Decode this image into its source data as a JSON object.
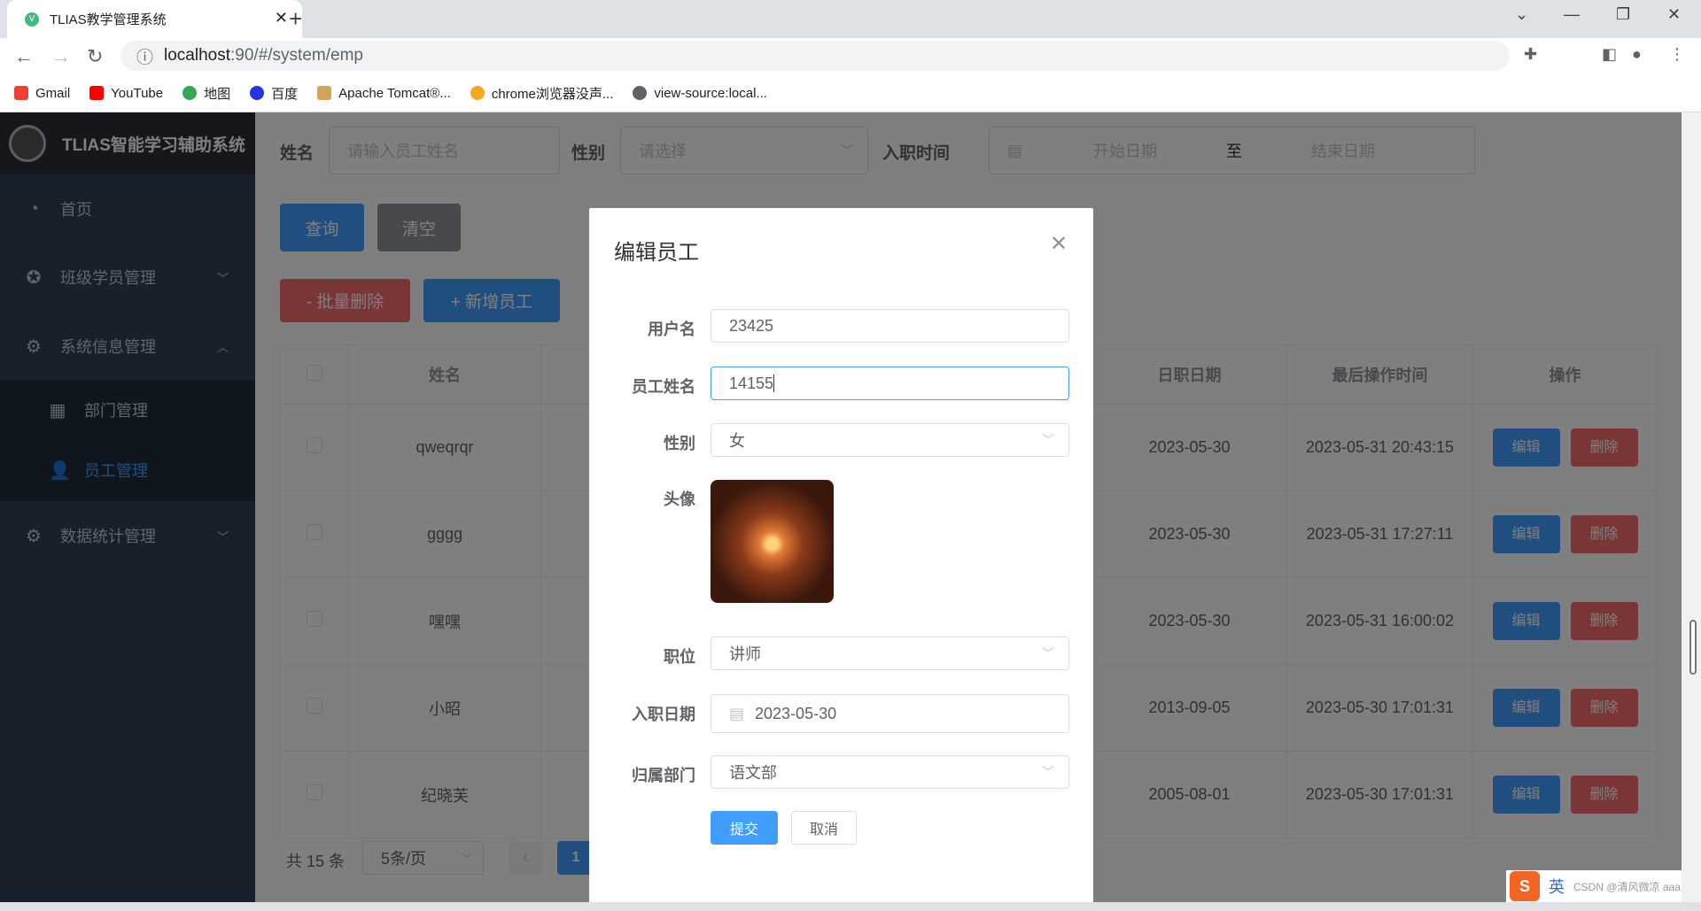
{
  "browser": {
    "tab_title": "TLIAS教学管理系统",
    "url_host": "localhost",
    "url_path": ":90/#/system/emp",
    "bookmarks": [
      {
        "label": "Gmail",
        "color": "#ea4335"
      },
      {
        "label": "YouTube",
        "color": "#ff0000"
      },
      {
        "label": "地图",
        "color": "#34a853"
      },
      {
        "label": "百度",
        "color": "#2932e1"
      },
      {
        "label": "Apache Tomcat®...",
        "color": "#d1a65a"
      },
      {
        "label": "chrome浏览器没声...",
        "color": "#f5a623"
      },
      {
        "label": "view-source:local...",
        "color": "#5f6368"
      }
    ]
  },
  "sidebar": {
    "app_title": "TLIAS智能学习辅助系统",
    "items": [
      {
        "label": "首页",
        "icon": "dashboard-icon"
      },
      {
        "label": "班级学员管理",
        "icon": "class-icon"
      },
      {
        "label": "系统信息管理",
        "icon": "gear-icon"
      },
      {
        "label": "部门管理",
        "icon": "grid-icon"
      },
      {
        "label": "员工管理",
        "icon": "user-icon"
      },
      {
        "label": "数据统计管理",
        "icon": "gear-icon"
      }
    ]
  },
  "filters": {
    "name_label": "姓名",
    "name_placeholder": "请输入员工姓名",
    "gender_label": "性别",
    "gender_placeholder": "请选择",
    "date_label": "入职时间",
    "start_placeholder": "开始日期",
    "range_sep": "至",
    "end_placeholder": "结束日期",
    "query": "查询",
    "clear": "清空",
    "batch_delete": "- 批量删除",
    "add": "+ 新增员工"
  },
  "table": {
    "headers": {
      "name": "姓名",
      "entry": "日职日期",
      "update": "最后操作时间",
      "ops": "操作"
    },
    "edit": "编辑",
    "delete": "删除",
    "rows": [
      {
        "name": "qweqrqr",
        "entry": "2023-05-30",
        "update": "2023-05-31 20:43:15"
      },
      {
        "name": "gggg",
        "entry": "2023-05-30",
        "update": "2023-05-31 17:27:11"
      },
      {
        "name": "嘿嘿",
        "entry": "2023-05-30",
        "update": "2023-05-31 16:00:02"
      },
      {
        "name": "小昭",
        "entry": "2013-09-05",
        "update": "2023-05-30 17:01:31"
      },
      {
        "name": "纪晓芙",
        "entry": "2005-08-01",
        "update": "2023-05-30 17:01:31"
      }
    ]
  },
  "pagination": {
    "total": "共 15 条",
    "page_size": "5条/页",
    "current": "1"
  },
  "dialog": {
    "title": "编辑员工",
    "username_label": "用户名",
    "username": "23425",
    "name_label": "员工姓名",
    "name": "14155",
    "gender_label": "性别",
    "gender": "女",
    "avatar_label": "头像",
    "job_label": "职位",
    "job": "讲师",
    "entry_label": "入职日期",
    "entry": "2023-05-30",
    "dept_label": "归属部门",
    "dept": "语文部",
    "submit": "提交",
    "cancel": "取消"
  },
  "ime": {
    "lang": "英",
    "watermark": "CSDN @清风微凉 aaa"
  },
  "colors": {
    "primary": "#409eff",
    "danger": "#f56c6c",
    "sidebar": "#304156"
  }
}
